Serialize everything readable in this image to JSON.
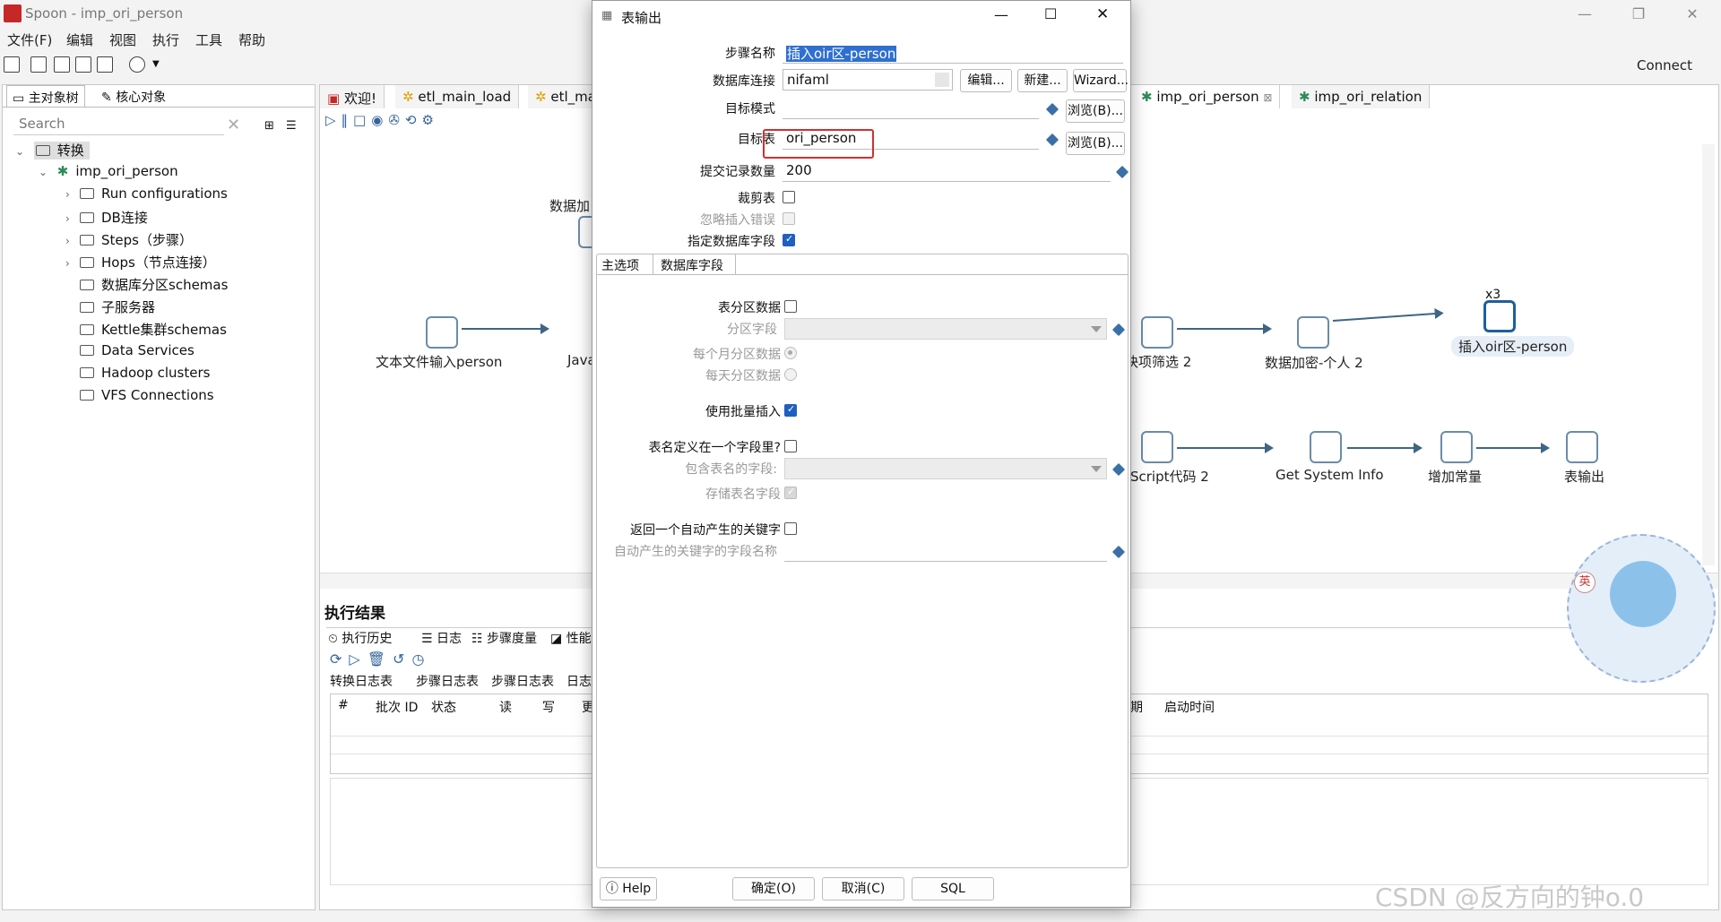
{
  "window": {
    "title": "Spoon - imp_ori_person",
    "connect": "Connect"
  },
  "menu": [
    "文件(F)",
    "编辑",
    "视图",
    "执行",
    "工具",
    "帮助"
  ],
  "left_panel": {
    "tabs": [
      "主对象树",
      "核心对象"
    ],
    "search_placeholder": "Search",
    "tree": {
      "root": "转换",
      "transform": "imp_ori_person",
      "children": [
        "Run configurations",
        "DB连接",
        "Steps（步骤）",
        "Hops（节点连接）",
        "数据库分区schemas",
        "子服务器",
        "Kettle集群schemas",
        "Data Services",
        "Hadoop clusters",
        "VFS Connections"
      ]
    }
  },
  "center_tabs": [
    "欢迎!",
    "etl_main_load",
    "etl_ma",
    "imp_ori_person",
    "imp_ori_relation"
  ],
  "canvas": {
    "nodes_row1": [
      "文本文件输入person",
      "Java",
      "数据加",
      "快项筛选 2",
      "数据加密-个人 2",
      "插入oir区-person"
    ],
    "copies_badge": "x3",
    "nodes_row2": [
      "Script代码 2",
      "Get System Info",
      "增加常量",
      "表输出"
    ]
  },
  "results": {
    "title": "执行结果",
    "tabs": [
      "执行历史",
      "日志",
      "步骤度量",
      "性能"
    ],
    "sub_tabs": [
      "转换日志表",
      "步骤日志表",
      "步骤日志表",
      "日志"
    ],
    "columns": [
      "#",
      "批次 ID",
      "状态",
      "读",
      "写",
      "更",
      "期",
      "启动时间"
    ]
  },
  "dialog": {
    "title": "表输出",
    "step_name_label": "步骤名称",
    "step_name": "插入oir区-person",
    "db_conn_label": "数据库连接",
    "db_conn": "nifaml",
    "edit_btn": "编辑...",
    "new_btn": "新建...",
    "wizard_btn": "Wizard...",
    "target_schema_label": "目标模式",
    "target_schema": "",
    "browse_btn": "浏览(B)...",
    "target_table_label": "目标表",
    "target_table": "ori_person",
    "commit_size_label": "提交记录数量",
    "commit_size": "200",
    "truncate_label": "裁剪表",
    "ignore_errors_label": "忽略插入错误",
    "specify_fields_label": "指定数据库字段",
    "tabs": [
      "主选项",
      "数据库字段"
    ],
    "partition_label": "表分区数据",
    "partition_field_label": "分区字段",
    "monthly_label": "每个月分区数据",
    "daily_label": "每天分区数据",
    "batch_label": "使用批量插入",
    "name_in_field_label": "表名定义在一个字段里?",
    "name_field_label": "包含表名的字段:",
    "store_name_label": "存储表名字段",
    "return_key_label": "返回一个自动产生的关键字",
    "key_field_label": "自动产生的关键字的字段名称",
    "help_btn": "Help",
    "ok_btn": "确定(O)",
    "cancel_btn": "取消(C)",
    "sql_btn": "SQL"
  },
  "watermark": "CSDN @反方向的钟o.0",
  "mascot_badge": "英",
  "colors": {
    "accent": "#1f5fbf",
    "highlight_box": "#d32f2f",
    "hop": "#3e6585",
    "selection": "#2f6fd0"
  }
}
